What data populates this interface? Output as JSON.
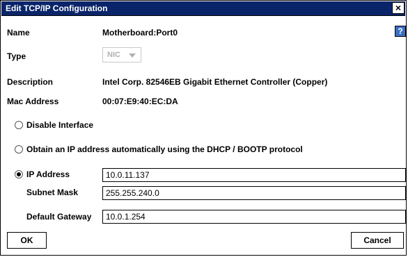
{
  "window": {
    "title": "Edit TCP/IP Configuration",
    "close_label": "×",
    "help_label": "?"
  },
  "fields": {
    "name_label": "Name",
    "name_value": "Motherboard:Port0",
    "type_label": "Type",
    "type_value": "NIC",
    "description_label": "Description",
    "description_value": "Intel Corp. 82546EB Gigabit Ethernet Controller (Copper)",
    "mac_label": "Mac Address",
    "mac_value": "00:07:E9:40:EC:DA"
  },
  "options": {
    "disable_label": "Disable Interface",
    "dhcp_label": "Obtain an IP address automatically using the DHCP / BOOTP protocol",
    "ip_label": "IP Address",
    "selected": "ip"
  },
  "ip_config": {
    "ip_value": "10.0.11.137",
    "subnet_label": "Subnet Mask",
    "subnet_value": "255.255.240.0",
    "gateway_label": "Default Gateway",
    "gateway_value": "10.0.1.254"
  },
  "buttons": {
    "ok_label": "OK",
    "cancel_label": "Cancel"
  },
  "colors": {
    "titlebar": "#0a246a",
    "help_icon": "#3a6fc4"
  }
}
